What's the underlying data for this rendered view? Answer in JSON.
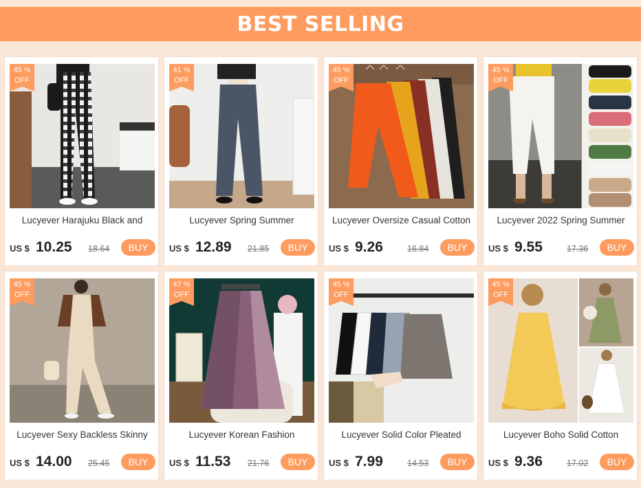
{
  "banner": {
    "title": "BEST SELLING"
  },
  "colors": {
    "accent": "#fe9b5e",
    "background": "#fbe7d8"
  },
  "products": [
    {
      "discount": "45 %",
      "off": "OFF",
      "title": "Lucyever Harajuku Black and",
      "currency": "US $",
      "price": "10.25",
      "old_price": "18.64",
      "buy": "BUY"
    },
    {
      "discount": "41 %",
      "off": "OFF",
      "title": "Lucyever Spring Summer",
      "currency": "US $",
      "price": "12.89",
      "old_price": "21.85",
      "buy": "BUY"
    },
    {
      "discount": "45 %",
      "off": "OFF",
      "title": "Lucyever Oversize Casual Cotton",
      "currency": "US $",
      "price": "9.26",
      "old_price": "16.84",
      "buy": "BUY"
    },
    {
      "discount": "45 %",
      "off": "OFF",
      "title": "Lucyever 2022 Spring Summer",
      "currency": "US $",
      "price": "9.55",
      "old_price": "17.36",
      "buy": "BUY"
    },
    {
      "discount": "45 %",
      "off": "OFF",
      "title": "Lucyever Sexy Backless Skinny",
      "currency": "US $",
      "price": "14.00",
      "old_price": "25.45",
      "buy": "BUY"
    },
    {
      "discount": "47 %",
      "off": "OFF",
      "title": "Lucyever Korean Fashion",
      "currency": "US $",
      "price": "11.53",
      "old_price": "21.76",
      "buy": "BUY"
    },
    {
      "discount": "45 %",
      "off": "OFF",
      "title": "Lucyever Solid Color  Pleated",
      "currency": "US $",
      "price": "7.99",
      "old_price": "14.53",
      "buy": "BUY"
    },
    {
      "discount": "45 %",
      "off": "OFF",
      "title": "Lucyever Boho Solid Cotton",
      "currency": "US $",
      "price": "9.36",
      "old_price": "17.02",
      "buy": "BUY"
    }
  ]
}
